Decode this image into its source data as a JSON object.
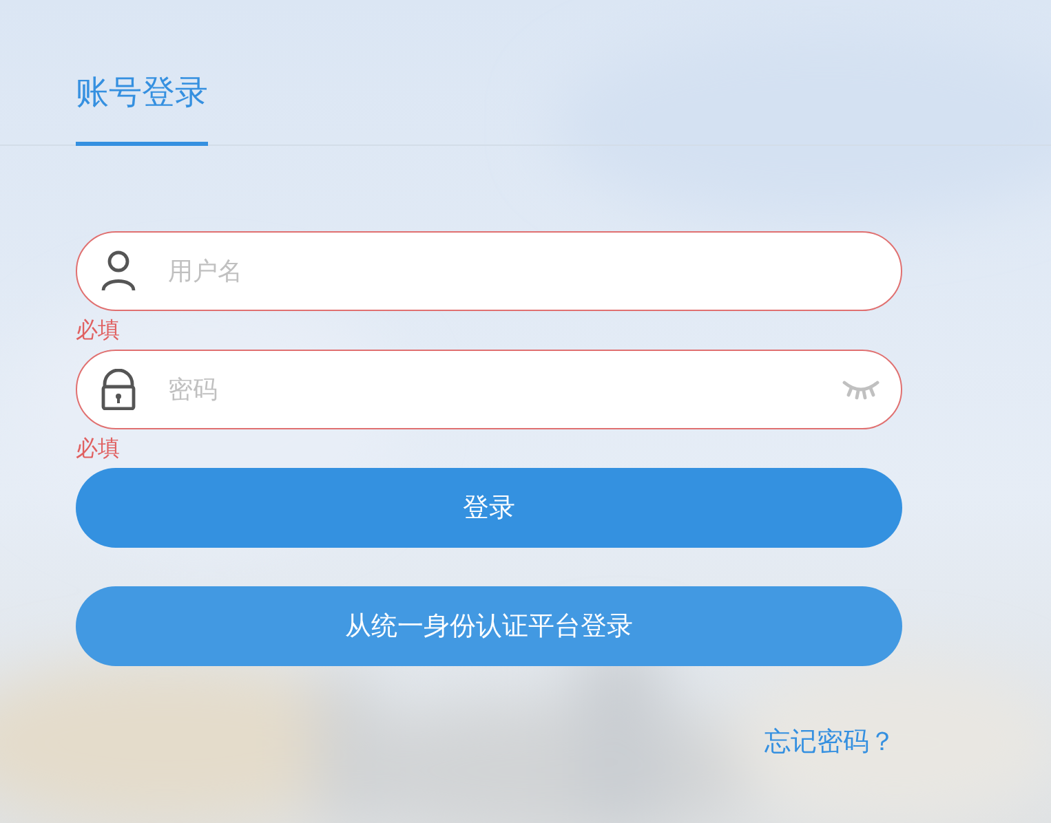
{
  "tabs": [
    {
      "label": "账号登录",
      "selected": true
    }
  ],
  "fields": [
    {
      "kind": "username",
      "placeholder": "用户名",
      "invalid": true,
      "error": "必填"
    },
    {
      "kind": "password",
      "placeholder": "密码",
      "invalid": true,
      "error": "必填",
      "reveal": false
    }
  ],
  "buttons": [
    {
      "label": "登录",
      "kind": "primary"
    },
    {
      "label": "从统一身份认证平台登录",
      "kind": "secondary"
    }
  ],
  "forgot_link": "忘记密码？"
}
